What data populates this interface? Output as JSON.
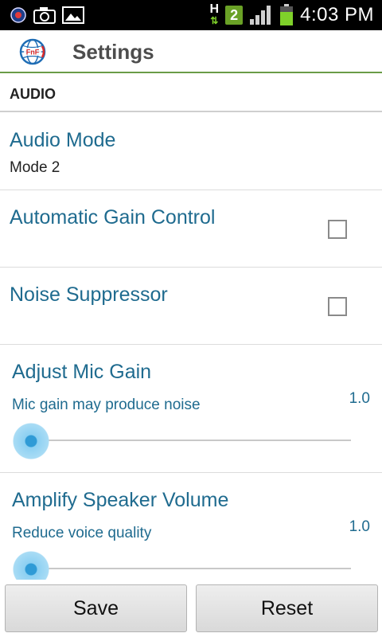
{
  "status_bar": {
    "time": "4:03 PM",
    "notification_badge": "2",
    "network_type": "H",
    "icons": [
      "app-notification-icon",
      "camera-icon",
      "gallery-icon",
      "hspa-data-icon",
      "notification-count-badge",
      "signal-icon",
      "battery-icon"
    ]
  },
  "action_bar": {
    "title": "Settings",
    "app_icon": "fnf-globe-icon"
  },
  "section": {
    "title": "AUDIO"
  },
  "prefs": {
    "audio_mode": {
      "title": "Audio Mode",
      "summary": "Mode 2"
    },
    "agc": {
      "title": "Automatic Gain Control",
      "checked": false
    },
    "noise": {
      "title": "Noise Suppressor",
      "checked": false
    },
    "mic_gain": {
      "title": "Adjust Mic Gain",
      "subtitle": "Mic gain may produce noise",
      "value": "1.0",
      "slider_fraction": 0.0
    },
    "speaker": {
      "title": "Amplify Speaker Volume",
      "subtitle": "Reduce voice quality",
      "value": "1.0",
      "slider_fraction": 0.0
    }
  },
  "buttons": {
    "save": "Save",
    "reset": "Reset"
  },
  "colors": {
    "accent_blue": "#1f6b8f",
    "action_bar_divider": "#6a9c47",
    "slider_thumb": "#2f9bd6"
  }
}
